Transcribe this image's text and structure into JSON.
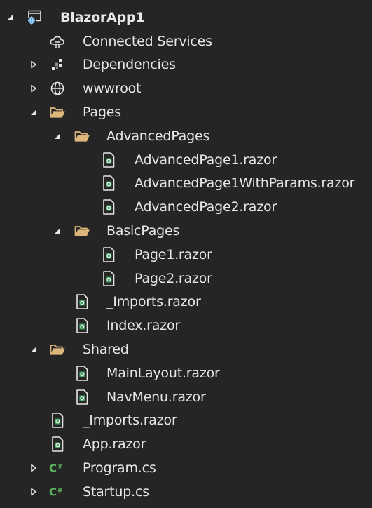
{
  "colors": {
    "background": "#252526",
    "text": "#e6e6e6",
    "arrow": "#e6e6e6",
    "folder": "#dcb67a",
    "razor_accent": "#3c9a5a",
    "csharp": "#5db25d",
    "project_blue": "#4f9fdc"
  },
  "tree": [
    {
      "label": "BlazorApp1",
      "level": 0,
      "arrow": "expanded",
      "icon": "project-icon",
      "kind": "project"
    },
    {
      "label": "Connected Services",
      "level": 1,
      "arrow": "none",
      "icon": "connected-services-icon",
      "kind": "node"
    },
    {
      "label": "Dependencies",
      "level": 1,
      "arrow": "collapsed",
      "icon": "dependencies-icon",
      "kind": "node"
    },
    {
      "label": "wwwroot",
      "level": 1,
      "arrow": "collapsed",
      "icon": "globe-icon",
      "kind": "node"
    },
    {
      "label": "Pages",
      "level": 1,
      "arrow": "expanded",
      "icon": "folder-open-icon",
      "kind": "folder"
    },
    {
      "label": "AdvancedPages",
      "level": 2,
      "arrow": "expanded",
      "icon": "folder-open-icon",
      "kind": "folder"
    },
    {
      "label": "AdvancedPage1.razor",
      "level": 3,
      "arrow": "none",
      "icon": "razor-file-icon",
      "kind": "file"
    },
    {
      "label": "AdvancedPage1WithParams.razor",
      "level": 3,
      "arrow": "none",
      "icon": "razor-file-icon",
      "kind": "file"
    },
    {
      "label": "AdvancedPage2.razor",
      "level": 3,
      "arrow": "none",
      "icon": "razor-file-icon",
      "kind": "file"
    },
    {
      "label": "BasicPages",
      "level": 2,
      "arrow": "expanded",
      "icon": "folder-open-icon",
      "kind": "folder"
    },
    {
      "label": "Page1.razor",
      "level": 3,
      "arrow": "none",
      "icon": "razor-file-icon",
      "kind": "file"
    },
    {
      "label": "Page2.razor",
      "level": 3,
      "arrow": "none",
      "icon": "razor-file-icon",
      "kind": "file"
    },
    {
      "label": "_Imports.razor",
      "level": 2,
      "arrow": "none",
      "icon": "razor-file-icon",
      "kind": "file"
    },
    {
      "label": "Index.razor",
      "level": 2,
      "arrow": "none",
      "icon": "razor-file-icon",
      "kind": "file"
    },
    {
      "label": "Shared",
      "level": 1,
      "arrow": "expanded",
      "icon": "folder-open-icon",
      "kind": "folder"
    },
    {
      "label": "MainLayout.razor",
      "level": 2,
      "arrow": "none",
      "icon": "razor-file-icon",
      "kind": "file"
    },
    {
      "label": "NavMenu.razor",
      "level": 2,
      "arrow": "none",
      "icon": "razor-file-icon",
      "kind": "file"
    },
    {
      "label": "_Imports.razor",
      "level": 1,
      "arrow": "none",
      "icon": "razor-file-icon",
      "kind": "file"
    },
    {
      "label": "App.razor",
      "level": 1,
      "arrow": "none",
      "icon": "razor-file-icon",
      "kind": "file"
    },
    {
      "label": "Program.cs",
      "level": 1,
      "arrow": "collapsed",
      "icon": "csharp-file-icon",
      "kind": "file"
    },
    {
      "label": "Startup.cs",
      "level": 1,
      "arrow": "collapsed",
      "icon": "csharp-file-icon",
      "kind": "file"
    }
  ]
}
